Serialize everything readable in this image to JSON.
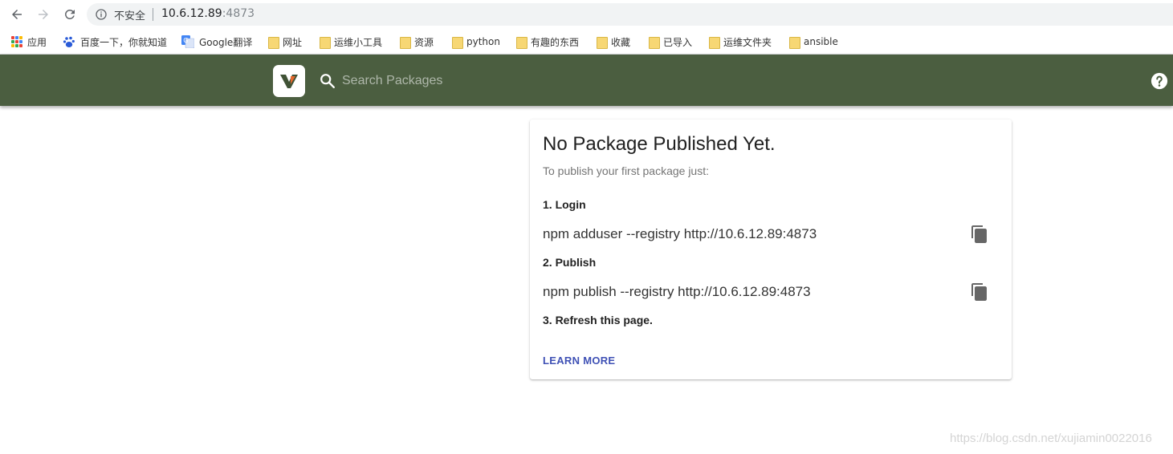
{
  "browser": {
    "security_label": "不安全",
    "url_host": "10.6.12.89",
    "url_port": ":4873",
    "bookmarks": [
      {
        "label": "应用",
        "icon": "apps-icon"
      },
      {
        "label": "百度一下，你就知道",
        "icon": "baidu-icon"
      },
      {
        "label": "Google翻译",
        "icon": "google-translate-icon"
      },
      {
        "label": "网址",
        "icon": "folder-icon"
      },
      {
        "label": "运维小工具",
        "icon": "folder-icon"
      },
      {
        "label": "资源",
        "icon": "folder-icon"
      },
      {
        "label": "python",
        "icon": "folder-icon"
      },
      {
        "label": "有趣的东西",
        "icon": "folder-icon"
      },
      {
        "label": "收藏",
        "icon": "folder-icon"
      },
      {
        "label": "已导入",
        "icon": "folder-icon"
      },
      {
        "label": "运维文件夹",
        "icon": "folder-icon"
      },
      {
        "label": "ansible",
        "icon": "folder-icon"
      }
    ]
  },
  "header": {
    "search_placeholder": "Search Packages",
    "color": "#4b5e40"
  },
  "card": {
    "title": "No Package Published Yet.",
    "subtitle": "To publish your first package just:",
    "steps": [
      {
        "label": "1. Login",
        "command": "npm adduser --registry http://10.6.12.89:4873"
      },
      {
        "label": "2. Publish",
        "command": "npm publish --registry http://10.6.12.89:4873"
      },
      {
        "label": "3. Refresh this page."
      }
    ],
    "learn_more": "LEARN MORE",
    "link_color": "#3f51b5"
  },
  "watermark": "https://blog.csdn.net/xujiamin0022016"
}
